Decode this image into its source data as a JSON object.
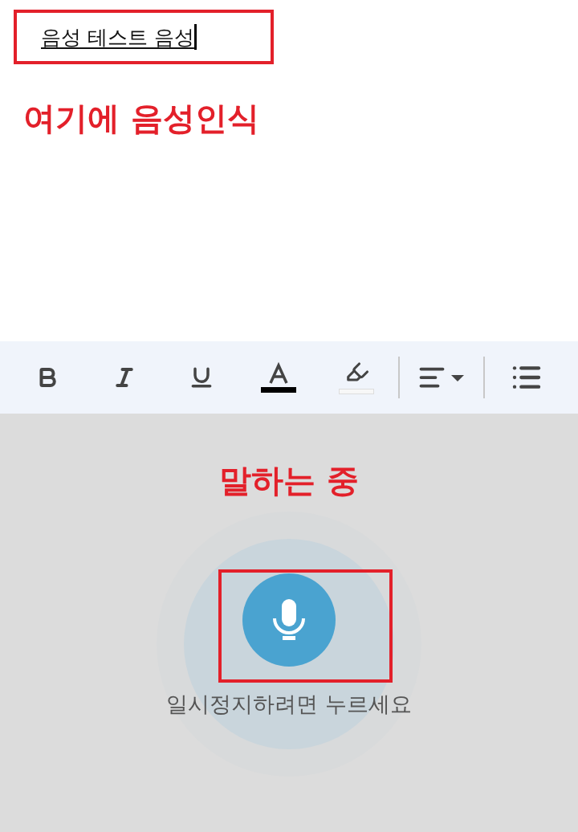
{
  "document": {
    "text": "음성 테스트 음성",
    "cursor": true
  },
  "annotation_note": "여기에 음성인식",
  "toolbar": {
    "buttons": [
      {
        "kind": "bold"
      },
      {
        "kind": "italic"
      },
      {
        "kind": "underline"
      },
      {
        "kind": "text-color"
      },
      {
        "kind": "highlight"
      },
      {
        "kind": "divider"
      },
      {
        "kind": "align"
      },
      {
        "kind": "divider"
      },
      {
        "kind": "list"
      }
    ]
  },
  "voice_panel": {
    "status": "말하는 중",
    "listening": true,
    "hint": "일시정지하려면 누르세요"
  }
}
